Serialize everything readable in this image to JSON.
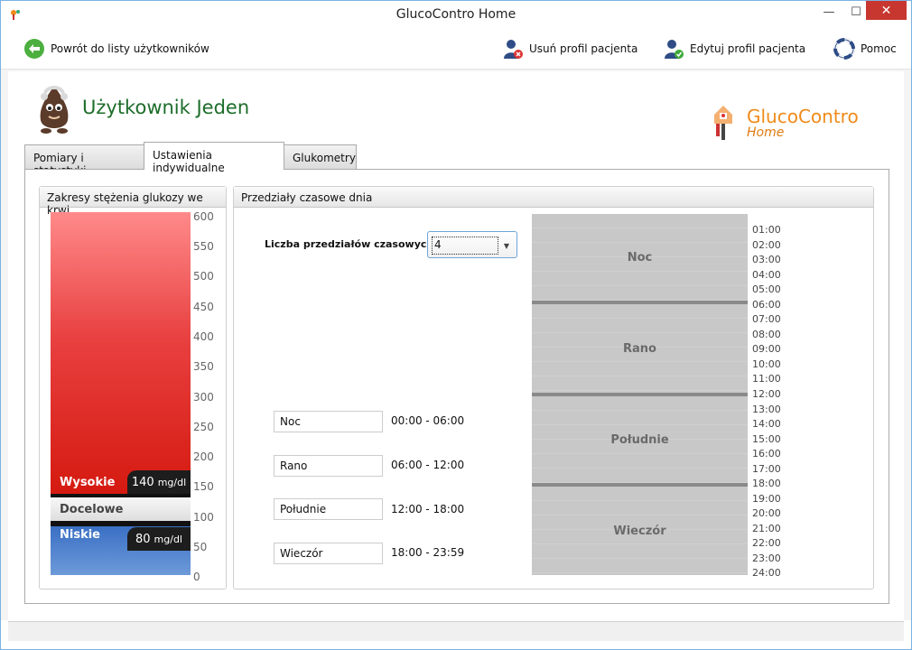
{
  "window": {
    "title": "GlucoContro Home"
  },
  "toolbar": {
    "back": "Powrót do listy użytkowników",
    "delete_profile": "Usuń profil pacjenta",
    "edit_profile": "Edytuj profil pacjenta",
    "help": "Pomoc"
  },
  "user": {
    "name": "Użytkownik Jeden"
  },
  "logo": {
    "brand": "GlucoContro",
    "sub": "Home"
  },
  "tabs": [
    {
      "label": "Pomiary i statystyki",
      "active": false
    },
    {
      "label": "Ustawienia indywidualne",
      "active": true
    },
    {
      "label": "Glukometry",
      "active": false
    }
  ],
  "glucose": {
    "title": "Zakresy stężenia glukozy we krwi",
    "high_label": "Wysokie",
    "high_value": "140",
    "target_label": "Docelowe",
    "low_label": "Niskie",
    "low_value": "80",
    "unit": "mg/dl",
    "ticks": [
      "600",
      "550",
      "500",
      "450",
      "400",
      "350",
      "300",
      "250",
      "200",
      "150",
      "100",
      "50",
      "0"
    ]
  },
  "intervals": {
    "title": "Przedziały czasowe dnia",
    "count_label": "Liczba przedziałów czasowych:",
    "count_value": "4",
    "items": [
      {
        "name": "Noc",
        "range": "00:00 - 06:00"
      },
      {
        "name": "Rano",
        "range": "06:00 - 12:00"
      },
      {
        "name": "Południe",
        "range": "12:00 - 18:00"
      },
      {
        "name": "Wieczór",
        "range": "18:00 - 23:59"
      }
    ],
    "hours": [
      "01:00",
      "02:00",
      "03:00",
      "04:00",
      "05:00",
      "06:00",
      "07:00",
      "08:00",
      "09:00",
      "10:00",
      "11:00",
      "12:00",
      "13:00",
      "14:00",
      "15:00",
      "16:00",
      "17:00",
      "18:00",
      "19:00",
      "20:00",
      "21:00",
      "22:00",
      "23:00",
      "24:00"
    ]
  }
}
